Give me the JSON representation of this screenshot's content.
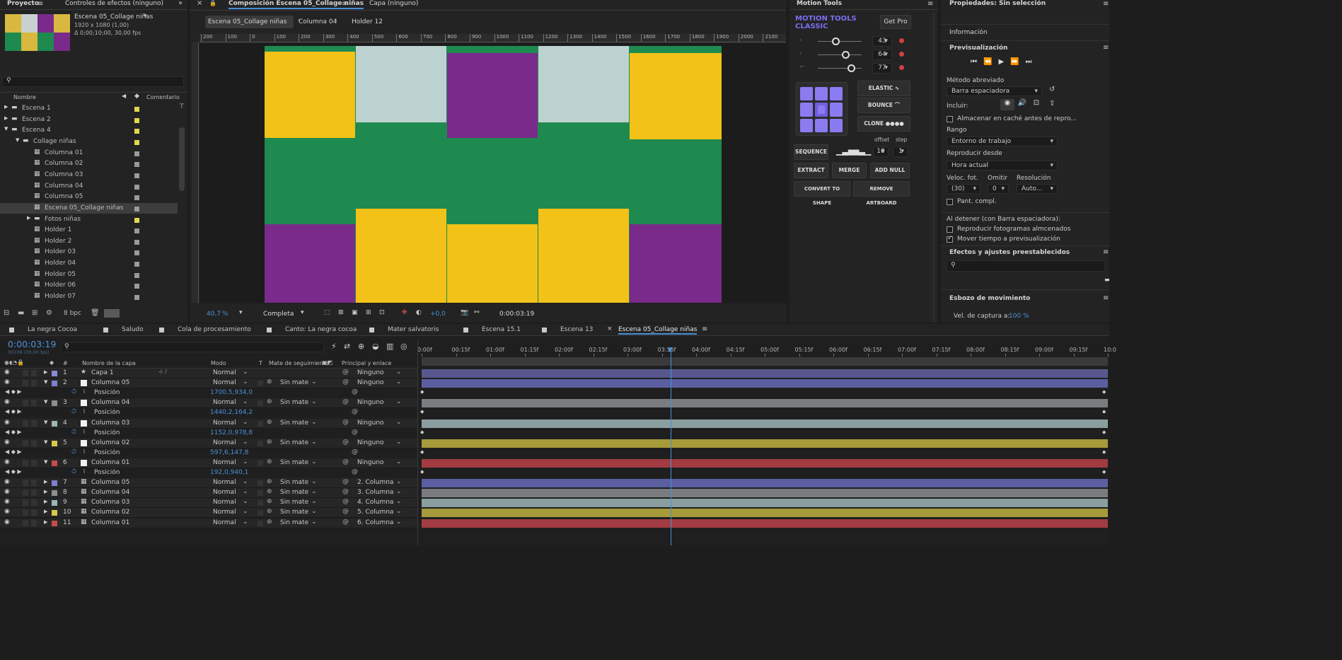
{
  "project": {
    "tab": "Proyecto",
    "effects_tab": "Controles de efectos (ninguno)",
    "comp_name": "Escena 05_Collage niñas",
    "comp_size": "1920 x 1080 (1,00)",
    "comp_duration": "Δ 0;00;10;00, 30,00 fps",
    "col_name": "Nombre",
    "col_comment": "Comentario",
    "bpc": "8 bpc",
    "items": [
      {
        "label": "Escena 1",
        "indent": 0,
        "type": "folder",
        "arrow": "▶",
        "color": "#e3d84a"
      },
      {
        "label": "Escena 2",
        "indent": 0,
        "type": "folder",
        "arrow": "▶",
        "color": "#e3d84a"
      },
      {
        "label": "Escena 4",
        "indent": 0,
        "type": "folder",
        "arrow": "▼",
        "color": "#e3d84a"
      },
      {
        "label": "Collage niñas",
        "indent": 1,
        "type": "folder",
        "arrow": "▼",
        "color": "#e3d84a"
      },
      {
        "label": "Columna 01",
        "indent": 2,
        "type": "comp",
        "arrow": "",
        "color": "#9a9a9a"
      },
      {
        "label": "Columna 02",
        "indent": 2,
        "type": "comp",
        "arrow": "",
        "color": "#9a9a9a"
      },
      {
        "label": "Columna 03",
        "indent": 2,
        "type": "comp",
        "arrow": "",
        "color": "#9a9a9a"
      },
      {
        "label": "Columna 04",
        "indent": 2,
        "type": "comp",
        "arrow": "",
        "color": "#9a9a9a"
      },
      {
        "label": "Columna 05",
        "indent": 2,
        "type": "comp",
        "arrow": "",
        "color": "#9a9a9a"
      },
      {
        "label": "Escena 05_Collage niñas",
        "indent": 2,
        "type": "comp",
        "arrow": "",
        "color": "#9a9a9a"
      },
      {
        "label": "Fotos niñas",
        "indent": 2,
        "type": "folder",
        "arrow": "▶",
        "color": "#e3d84a"
      },
      {
        "label": "Holder 1",
        "indent": 2,
        "type": "comp",
        "arrow": "",
        "color": "#9a9a9a"
      },
      {
        "label": "Holder 2",
        "indent": 2,
        "type": "comp",
        "arrow": "",
        "color": "#9a9a9a"
      },
      {
        "label": "Holder 03",
        "indent": 2,
        "type": "comp",
        "arrow": "",
        "color": "#9a9a9a"
      },
      {
        "label": "Holder 04",
        "indent": 2,
        "type": "comp",
        "arrow": "",
        "color": "#9a9a9a"
      },
      {
        "label": "Holder 05",
        "indent": 2,
        "type": "comp",
        "arrow": "",
        "color": "#9a9a9a"
      },
      {
        "label": "Holder 06",
        "indent": 2,
        "type": "comp",
        "arrow": "",
        "color": "#9a9a9a"
      },
      {
        "label": "Holder 07",
        "indent": 2,
        "type": "comp",
        "arrow": "",
        "color": "#9a9a9a"
      }
    ]
  },
  "viewer": {
    "tab": "Composición Escena 05_Collage niñas",
    "layer_tab": "Capa (ninguno)",
    "crumbs": [
      "Escena 05_Collage niñas",
      "Columna 04",
      "Holder 12"
    ],
    "ruler": [
      "200",
      "100",
      "0",
      "100",
      "200",
      "300",
      "400",
      "500",
      "600",
      "700",
      "800",
      "900",
      "1000",
      "1100",
      "1200",
      "1300",
      "1400",
      "1500",
      "1600",
      "1700",
      "1800",
      "1900",
      "2000",
      "2100"
    ],
    "zoom": "40,7",
    "zoom_unit": "%",
    "quality": "Completa",
    "exposure": "+0,0",
    "time": "0:00:03:19"
  },
  "motion": {
    "tab": "Motion Tools",
    "brand1": "MOTION TOOLS",
    "brand2": "CLASSIC",
    "getpro": "Get Pro",
    "sliders": [
      "43",
      "64",
      "77"
    ],
    "elastic": "ELASTIC",
    "bounce": "BOUNCE",
    "clone": "CLONE",
    "offset_label": "offset",
    "step_label": "step",
    "sequence": "SEQUENCE",
    "offset": "10",
    "step": "1",
    "extract": "EXTRACT",
    "merge": "MERGE",
    "addnull": "ADD NULL",
    "convert": "CONVERT TO SHAPE",
    "remove": "REMOVE ARTBOARD"
  },
  "props": {
    "title": "Propiedades: Sin selección",
    "info": "Información",
    "preview": "Previsualización",
    "shortcut_label": "Método abreviado",
    "shortcut": "Barra espaciadora",
    "include": "Incluir:",
    "cache": "Almacenar en caché antes de repro...",
    "range_label": "Rango",
    "range": "Entorno de trabajo",
    "from_label": "Reproducir desde",
    "from": "Hora actual",
    "fps_label": "Veloc. fot.",
    "skip_label": "Omitir",
    "res_label": "Resolución",
    "fps": "(30)",
    "skip": "0",
    "res": "Auto...",
    "fullscreen": "Pant. compl.",
    "onstop": "Al detener (con Barra espaciadora):",
    "cached": "Reproducir fotogramas almcenados",
    "movetime": "Mover tiempo a previsualización",
    "effects": "Efectos y ajustes preestablecidos",
    "sketch": "Esbozo de movimiento",
    "capture_label": "Vel. de captura a:",
    "capture": "100 %"
  },
  "tabs": [
    "La negra Cocoa",
    "Saludo",
    "Cola de procesamiento",
    "Canto: La negra cocoa",
    "Mater salvatoris",
    "Escena 15.1",
    "Escena 13",
    "Escena 05_Collage niñas"
  ],
  "timeline": {
    "time": "0:00:03:19",
    "frames": "00109 (30,00 fps)",
    "col_layer": "Nombre de la capa",
    "col_mode": "Modo",
    "col_t": "T",
    "col_matte": "Mate de seguimiento",
    "col_parent": "Principal y enlace",
    "ticks": [
      "0:00f",
      "00:15f",
      "01:00f",
      "01:15f",
      "02:00f",
      "02:15f",
      "03:00f",
      "03:15f",
      "04:00f",
      "04:15f",
      "05:00f",
      "05:15f",
      "06:00f",
      "06:15f",
      "07:00f",
      "07:15f",
      "08:00f",
      "08:15f",
      "09:00f",
      "09:15f",
      "10:0"
    ],
    "layers": [
      {
        "n": "1",
        "name": "Capa 1",
        "type": "star",
        "mode": "Normal",
        "matte": "",
        "parent": "Ninguno",
        "color": "#8a8ad6",
        "bar": "#58588f"
      },
      {
        "n": "2",
        "name": "Columna 05",
        "type": "solid",
        "mode": "Normal",
        "matte": "Sin mate",
        "parent": "Ninguno",
        "color": "#7f7fd0",
        "bar": "#5b5fa1",
        "prop": "Posición",
        "value": "1700,5,934,0"
      },
      {
        "n": "3",
        "name": "Columna 04",
        "type": "solid",
        "mode": "Normal",
        "matte": "Sin mate",
        "parent": "Ninguno",
        "color": "#8e8e8e",
        "bar": "#7a7c80",
        "prop": "Posición",
        "value": "1440,2,164,2"
      },
      {
        "n": "4",
        "name": "Columna 03",
        "type": "solid",
        "mode": "Normal",
        "matte": "Sin mate",
        "parent": "Ninguno",
        "color": "#9ab6b6",
        "bar": "#8a9e9f",
        "prop": "Posición",
        "value": "1152,0,978,8"
      },
      {
        "n": "5",
        "name": "Columna 02",
        "type": "solid",
        "mode": "Normal",
        "matte": "Sin mate",
        "parent": "Ninguno",
        "color": "#d6c84a",
        "bar": "#a69a3a",
        "prop": "Posición",
        "value": "597,6,147,8"
      },
      {
        "n": "6",
        "name": "Columna 01",
        "type": "solid",
        "mode": "Normal",
        "matte": "Sin mate",
        "parent": "Ninguno",
        "color": "#c84a4a",
        "bar": "#a23c42",
        "prop": "Posición",
        "value": "192,0,940,1"
      },
      {
        "n": "7",
        "name": "Columna 05",
        "type": "comp",
        "mode": "Normal",
        "matte": "Sin mate",
        "parent": "2. Columna",
        "color": "#7f7fd0",
        "bar": "#5b5fa1"
      },
      {
        "n": "8",
        "name": "Columna 04",
        "type": "comp",
        "mode": "Normal",
        "matte": "Sin mate",
        "parent": "3. Columna",
        "color": "#8e8e8e",
        "bar": "#7a7c80"
      },
      {
        "n": "9",
        "name": "Columna 03",
        "type": "comp",
        "mode": "Normal",
        "matte": "Sin mate",
        "parent": "4. Columna",
        "color": "#9ab6b6",
        "bar": "#8a9e9f"
      },
      {
        "n": "10",
        "name": "Columna 02",
        "type": "comp",
        "mode": "Normal",
        "matte": "Sin mate",
        "parent": "5. Columna",
        "color": "#d6c84a",
        "bar": "#a69a3a"
      },
      {
        "n": "11",
        "name": "Columna 01",
        "type": "comp",
        "mode": "Normal",
        "matte": "Sin mate",
        "parent": "6. Columna",
        "color": "#c84a4a",
        "bar": "#a23c42"
      }
    ]
  }
}
